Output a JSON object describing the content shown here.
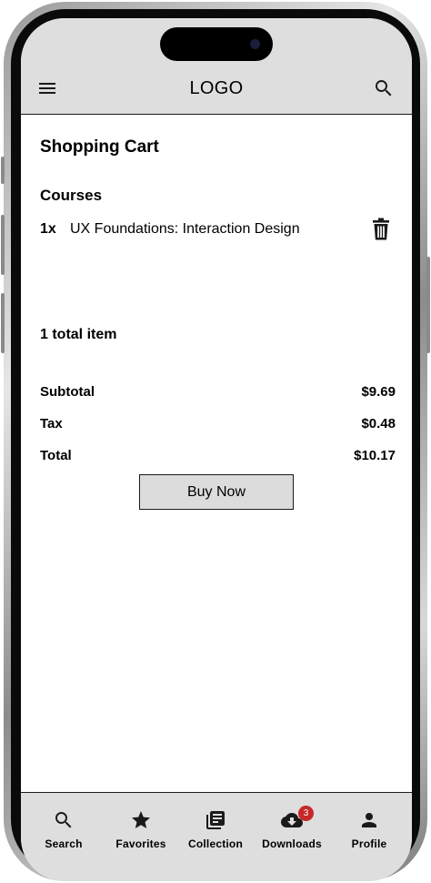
{
  "header": {
    "logo": "LOGO",
    "menu_icon": "hamburger-menu-icon",
    "search_icon": "search-icon"
  },
  "cart": {
    "title": "Shopping Cart",
    "section_title": "Courses",
    "items": [
      {
        "quantity": "1x",
        "name": "UX Foundations: Interaction Design",
        "action_icon": "trash-icon"
      }
    ],
    "total_items": "1 total item",
    "subtotal_label": "Subtotal",
    "subtotal_value": "$9.69",
    "tax_label": "Tax",
    "tax_value": "$0.48",
    "total_label": "Total",
    "total_value": "$10.17",
    "buy_label": "Buy Now"
  },
  "nav": {
    "items": [
      {
        "label": "Search",
        "icon": "search-icon"
      },
      {
        "label": "Favorites",
        "icon": "star-icon"
      },
      {
        "label": "Collection",
        "icon": "library-icon"
      },
      {
        "label": "Downloads",
        "icon": "cloud-download-icon",
        "badge": "3"
      },
      {
        "label": "Profile",
        "icon": "person-icon"
      }
    ]
  },
  "colors": {
    "header_bg": "#dedede",
    "badge": "#c62828",
    "button_bg": "#dcdcdc"
  }
}
